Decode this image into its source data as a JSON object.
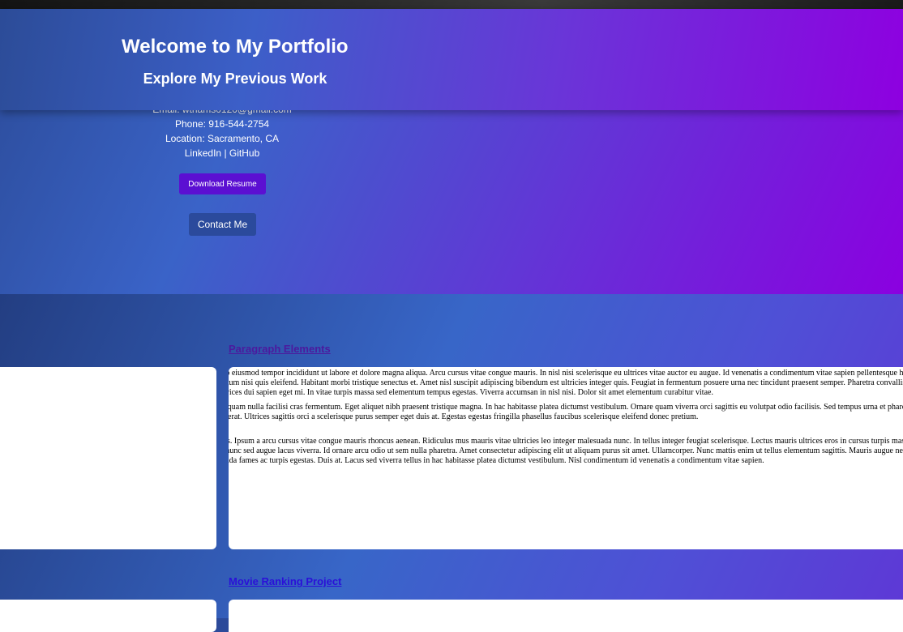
{
  "header": {
    "title": "Welcome to My Portfolio",
    "subtitle": "Explore My Previous Work"
  },
  "contact": {
    "email": "Email: wthams0120@gmail.com",
    "phone": "Phone: 916-544-2754",
    "location": "Location: Sacramento, CA",
    "linkedin": "LinkedIn",
    "separator": " | ",
    "github": "GitHub",
    "resume_button": "Download Resume",
    "contact_button": "Contact Me"
  },
  "projects": [
    {
      "title": "Paragraph Elements",
      "paragraphs": [
        "Lorem ipsum dolor sit amet, consectetur adipiscing elit, sed do eiusmod tempor incididunt ut labore et dolore magna aliqua. Arcu cursus vitae congue mauris. In nisl nisi scelerisque eu ultrices vitae auctor eu augue. Id venenatis a condimentum vitae sapien pellentesque habitant. Tellus integer feugiat scelerisque. Quis ipsum suspendisse ultrices gravida dictum fusce ut. Euismod elementum nisi quis eleifend. Habitant morbi tristique senectus et. Amet nisl suscipit adipiscing bibendum est ultricies integer quis. Feugiat in fermentum posuere urna nec tincidunt praesent semper. Pharetra convallis a cras semper auctor neque vitae. Magna fermentum iaculis eu non. Vivamus arcu felis bibendum ut tristique et. Justo nec ultrices dui sapien eget mi. In vitae turpis massa sed elementum tempus egestas. Viverra accumsan in nisl nisi. Dolor sit amet elementum curabitur vitae.",
        "Amet nisl suscipit adipiscing bibendum est ultricies. Tortor aliquam nulla facilisi cras fermentum. Eget aliquet nibh praesent tristique magna. In hac habitasse platea dictumst vestibulum. Ornare quam viverra orci sagittis eu volutpat odio facilisis. Sed tempus urna et pharetra pharetra massa massa. Bibendum neque egestas congue. Enim eu turpis egestas pretium aenean pharetra magna ac placerat. Ultrices sagittis orci a scelerisque purus semper eget duis at. Egestas egestas fringilla phasellus faucibus scelerisque eleifend donec pretium.",
        "Nisl pretium fusce id velit ut tortor pretium sed id semper risus. Ipsum a arcu cursus vitae congue mauris rhoncus aenean. Ridiculus mus mauris vitae ultricies leo integer malesuada nunc. In tellus integer feugiat scelerisque. Lectus mauris ultrices eros in cursus turpis massa tincidunt. Quis hendrerit dolor. Quam elementum pulvinar etiam non quam lacus suspendisse faucibus interdum. Iaculis nunc sed augue lacus viverra. Id ornare arcu odio ut sem nulla pharetra. Amet consectetur adipiscing elit ut aliquam purus sit amet. Ullamcorper. Nunc mattis enim ut tellus elementum sagittis. Mauris augue neque gravida in fermentum et sollicitudin. Pellentesque habitant morbi tristique senectus. Tristique senectus et netus et malesuada fames ac turpis egestas. Duis at. Lacus sed viverra tellus in hac habitasse platea dictumst vestibulum. Nisl condimentum id venenatis a condimentum vitae sapien."
      ]
    },
    {
      "title": "Movie Ranking Project"
    }
  ],
  "colors": {
    "resume_button": "#5b0fd2",
    "contact_button": "#2b4a9c",
    "project_link_1": "#4b1a9e",
    "project_link_2": "#2a10d8"
  }
}
